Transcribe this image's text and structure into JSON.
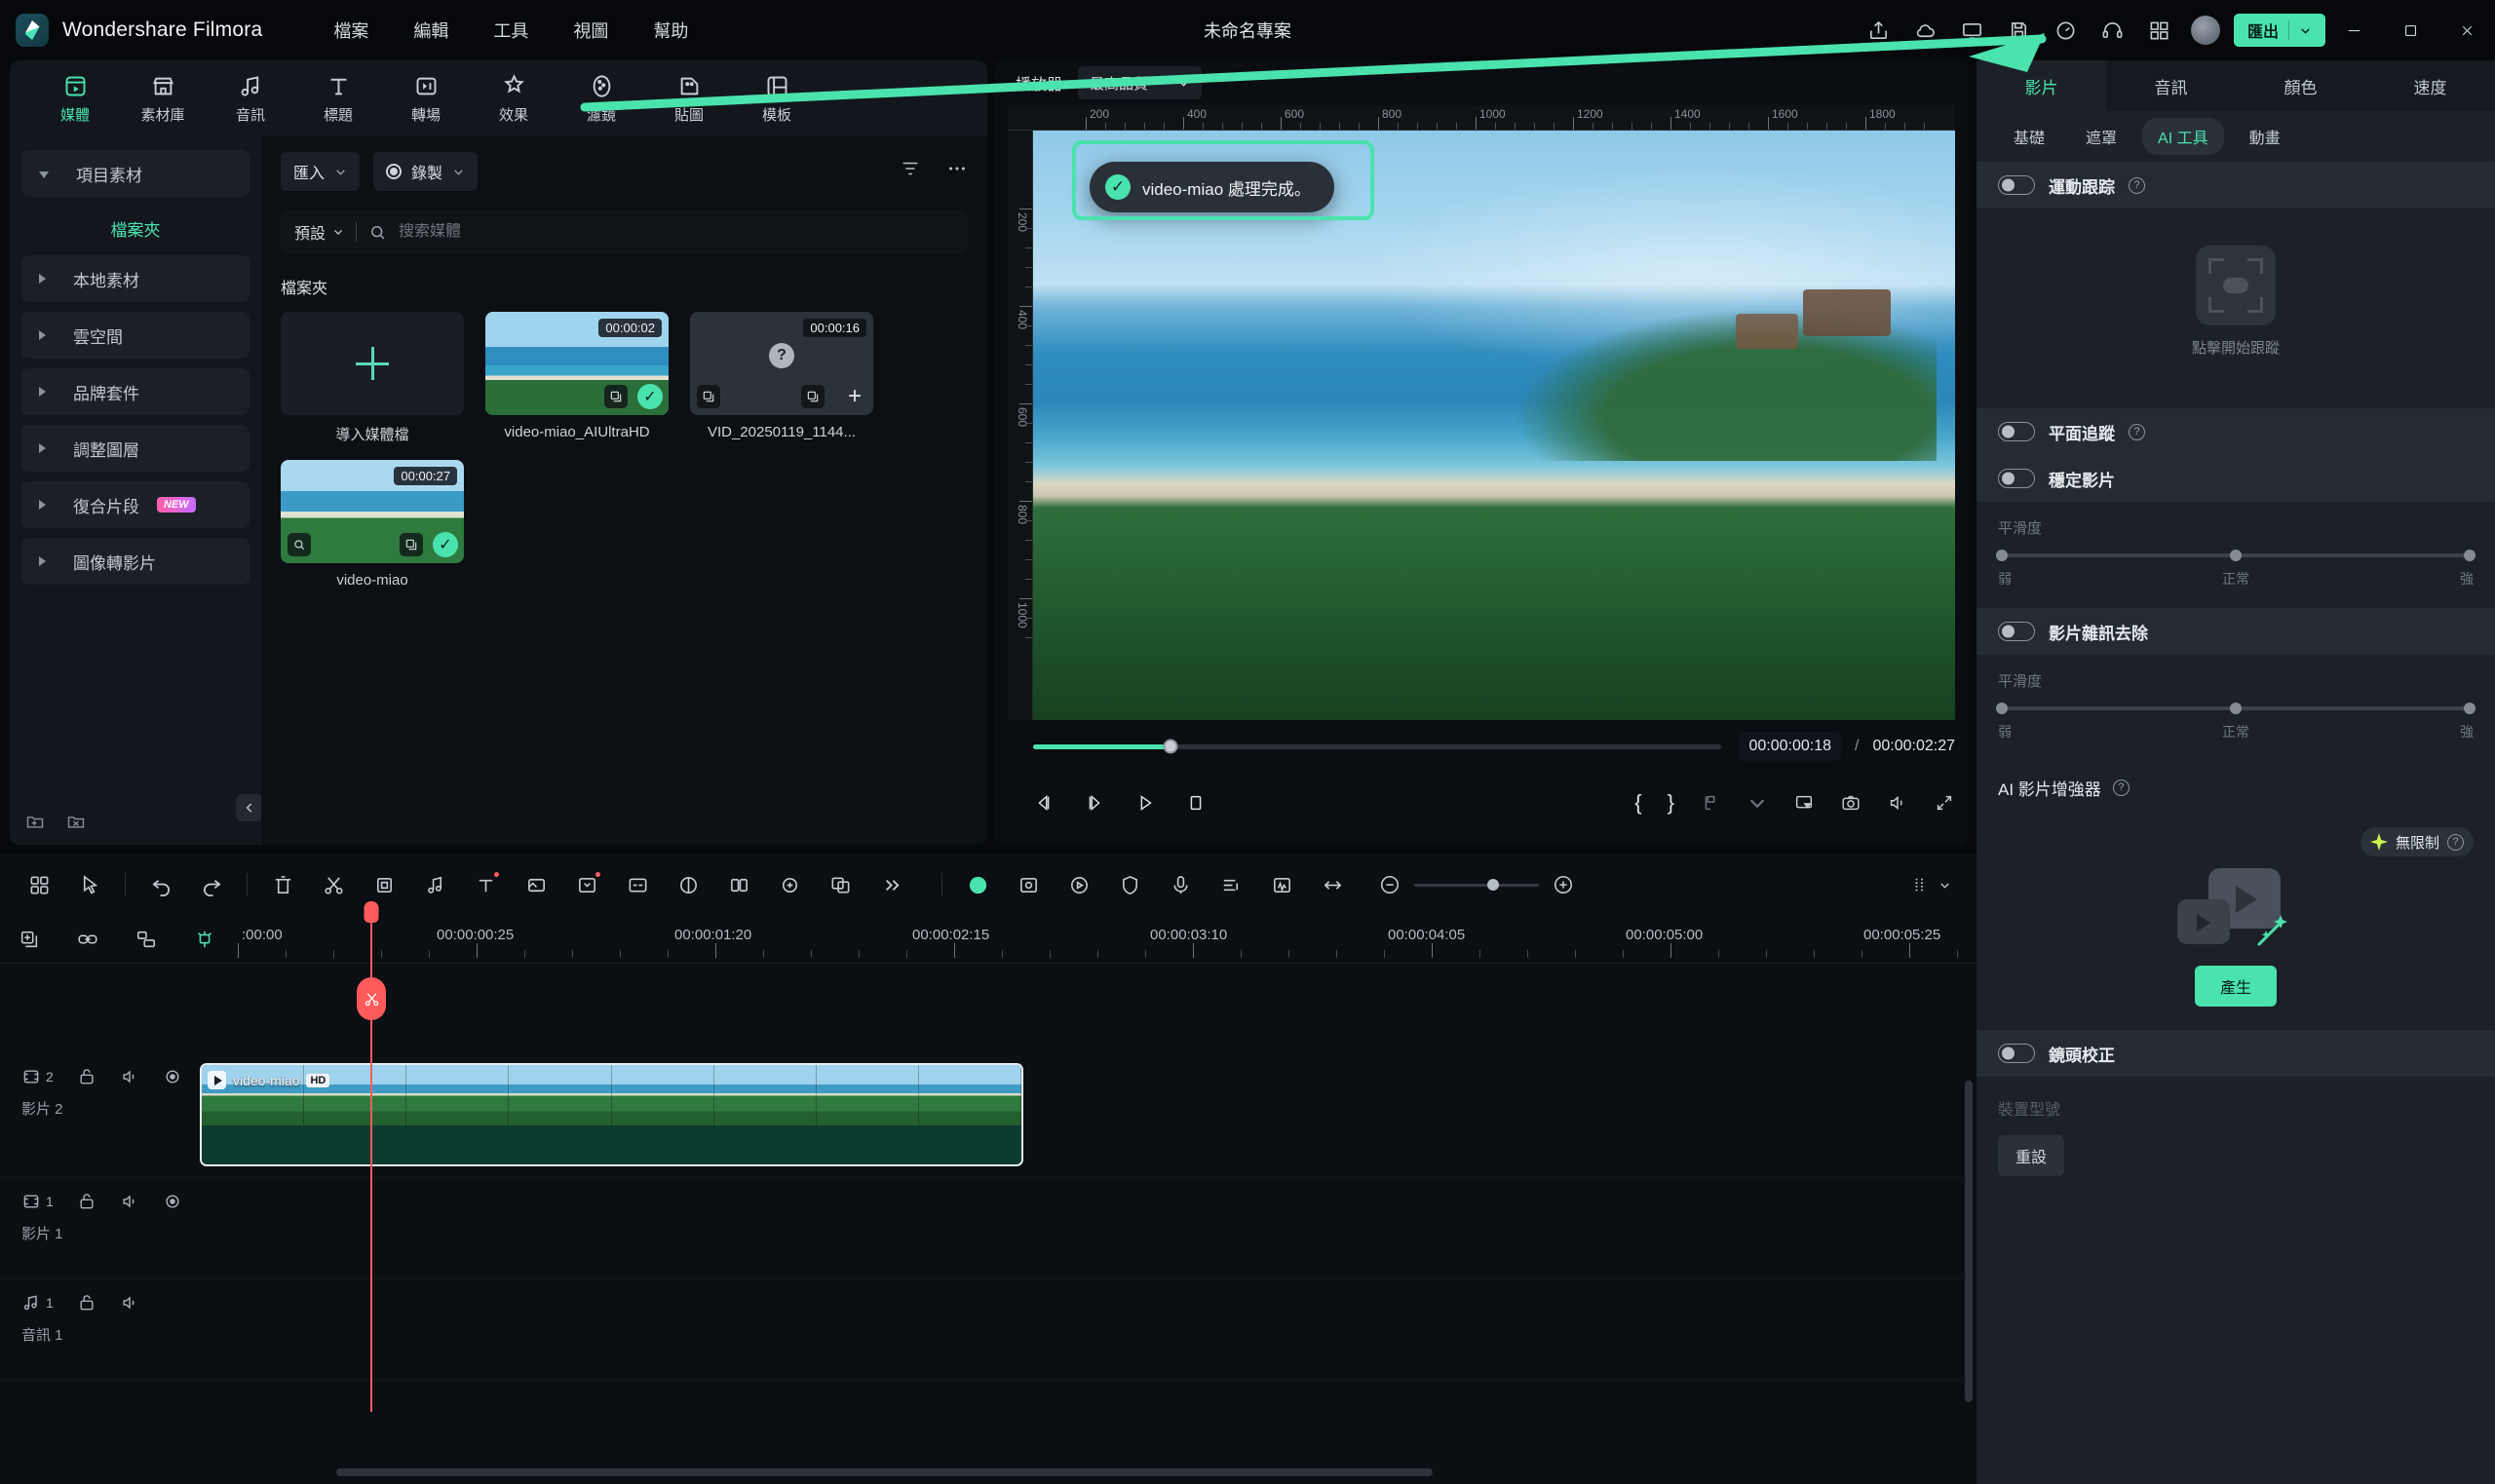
{
  "titlebar": {
    "brand": "Wondershare Filmora",
    "menus": [
      "檔案",
      "編輯",
      "工具",
      "視圖",
      "幫助"
    ],
    "project_title": "未命名專案",
    "export_label": "匯出",
    "icons": [
      "share-icon",
      "cloud-icon",
      "screen-icon",
      "save-icon",
      "speed-icon",
      "headset-icon",
      "grid-icon"
    ],
    "window_controls": [
      "minimize",
      "maximize",
      "close"
    ]
  },
  "tabs": [
    {
      "label": "媒體",
      "icon": "media-icon",
      "active": true
    },
    {
      "label": "素材庫",
      "icon": "stock-icon",
      "active": false
    },
    {
      "label": "音訊",
      "icon": "audio-icon",
      "active": false
    },
    {
      "label": "標題",
      "icon": "title-icon",
      "active": false
    },
    {
      "label": "轉場",
      "icon": "transition-icon",
      "active": false
    },
    {
      "label": "效果",
      "icon": "effects-icon",
      "active": false
    },
    {
      "label": "濾鏡",
      "icon": "filter-icon",
      "active": false
    },
    {
      "label": "貼圖",
      "icon": "sticker-icon",
      "active": false
    },
    {
      "label": "模板",
      "icon": "template-icon",
      "active": false
    }
  ],
  "sidebar": {
    "items": [
      {
        "label": "項目素材",
        "expanded": true
      },
      {
        "label": "本地素材",
        "expanded": false
      },
      {
        "label": "雲空間",
        "expanded": false
      },
      {
        "label": "品牌套件",
        "expanded": false
      },
      {
        "label": "調整圖層",
        "expanded": false
      },
      {
        "label": "復合片段",
        "expanded": false,
        "badge": "NEW"
      },
      {
        "label": "圖像轉影片",
        "expanded": false
      }
    ],
    "sub_label": "檔案夾"
  },
  "media": {
    "import_label": "匯入",
    "record_label": "錄製",
    "preset_label": "預設",
    "search_placeholder": "搜索媒體",
    "section_title": "檔案夾",
    "import_cell_label": "導入媒體檔",
    "items": [
      {
        "name": "video-miao_AIUltraHD",
        "duration": "00:00:02",
        "selected": true,
        "processed": true
      },
      {
        "name": "VID_20250119_1144...",
        "duration": "00:00:16",
        "selected": false,
        "processed": false
      },
      {
        "name": "video-miao",
        "duration": "00:00:27",
        "selected": false,
        "processed": true
      }
    ]
  },
  "player": {
    "label": "播放器",
    "quality": "最高品質",
    "current_time": "00:00:00:18",
    "total_time": "00:00:02:27",
    "separator": "/",
    "ruler_h": [
      "200",
      "400",
      "600",
      "800",
      "1000",
      "1200",
      "1400",
      "1600",
      "1800"
    ],
    "ruler_v": [
      "200",
      "400",
      "600",
      "800",
      "1000"
    ],
    "toast": "video-miao 處理完成。",
    "controls": [
      "prev-frame",
      "next-frame",
      "play",
      "stop",
      "mark-in",
      "mark-out",
      "snapshot-menu",
      "screen-icon",
      "camera-icon",
      "volume-icon",
      "fullscreen-icon"
    ]
  },
  "right_panel": {
    "tabs": [
      {
        "label": "影片",
        "active": true
      },
      {
        "label": "音訊",
        "active": false
      },
      {
        "label": "顏色",
        "active": false
      },
      {
        "label": "速度",
        "active": false
      }
    ],
    "subtabs": [
      {
        "label": "基礎",
        "active": false
      },
      {
        "label": "遮罩",
        "active": false
      },
      {
        "label": "AI 工具",
        "active": true
      },
      {
        "label": "動畫",
        "active": false
      }
    ],
    "motion_tracking": {
      "label": "運動跟踪",
      "enabled": false,
      "hint": "點擊開始跟蹤"
    },
    "planar_tracking": {
      "label": "平面追蹤",
      "enabled": false
    },
    "stabilize": {
      "label": "穩定影片",
      "enabled": false
    },
    "smooth1": {
      "label": "平滑度",
      "left": "弱",
      "mid": "正常",
      "right": "強"
    },
    "denoise": {
      "label": "影片雜訊去除",
      "enabled": false
    },
    "smooth2": {
      "label": "平滑度",
      "left": "弱",
      "mid": "正常",
      "right": "強"
    },
    "enhancer": {
      "title": "AI 影片增強器",
      "badge": "無限制",
      "generate": "產生"
    },
    "lens": {
      "label": "鏡頭校正",
      "enabled": false,
      "device_label": "裝置型號",
      "reset": "重設"
    }
  },
  "timeline": {
    "tools": [
      "grid-icon",
      "cursor-icon",
      "undo-icon",
      "redo-icon",
      "delete-icon",
      "split-icon",
      "crop-icon",
      "audio-detach-icon",
      "text-icon",
      "mask-icon",
      "keyframe-icon",
      "auto-caption-icon",
      "color-match-icon",
      "speed-ramp-icon",
      "mix-icon",
      "translate-icon",
      "more-icon"
    ],
    "tools_right": [
      "record-icon",
      "green-screen-icon",
      "motion-icon",
      "shield-icon",
      "mic-icon",
      "list-icon",
      "beat-icon",
      "fit-icon"
    ],
    "header_icons": [
      "add-track-icon",
      "link-icon",
      "group-icon",
      "marker-icon"
    ],
    "ruler_marks": [
      ":00:00",
      "00:00:00:25",
      "00:00:01:20",
      "00:00:02:15",
      "00:00:03:10",
      "00:00:04:05",
      "00:00:05:00",
      "00:00:05:25"
    ],
    "tracks": [
      {
        "name": "影片 2",
        "index": "2",
        "type": "video",
        "clip": {
          "label": "video-miao",
          "badge": "HD"
        }
      },
      {
        "name": "影片 1",
        "index": "1",
        "type": "video",
        "clip": null
      },
      {
        "name": "音訊 1",
        "index": "1",
        "type": "audio",
        "clip": null
      }
    ]
  },
  "colors": {
    "accent": "#4ae3ae",
    "playhead": "#ff5b5b",
    "panel_bg": "#1c2128",
    "app_bg": "#07090c",
    "badge_lime": "#c9f24a"
  }
}
